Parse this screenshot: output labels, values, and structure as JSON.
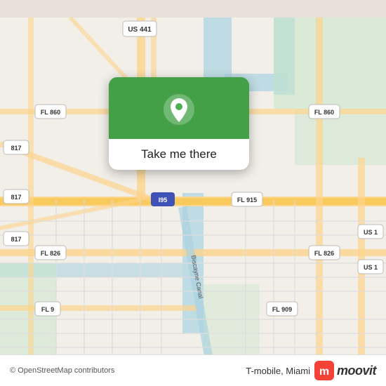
{
  "map": {
    "background_color": "#e8e0d8",
    "attribution": "© OpenStreetMap contributors"
  },
  "popup": {
    "button_label": "Take me there",
    "icon": "location-pin-icon",
    "background_color": "#4caf50",
    "icon_bg_color": "#43a047"
  },
  "bottom_bar": {
    "app_name": "T-mobile",
    "city": "Miami",
    "app_name_city": "T-mobile, Miami",
    "moovit_label": "moovit",
    "moovit_icon_color": "#f44336"
  }
}
